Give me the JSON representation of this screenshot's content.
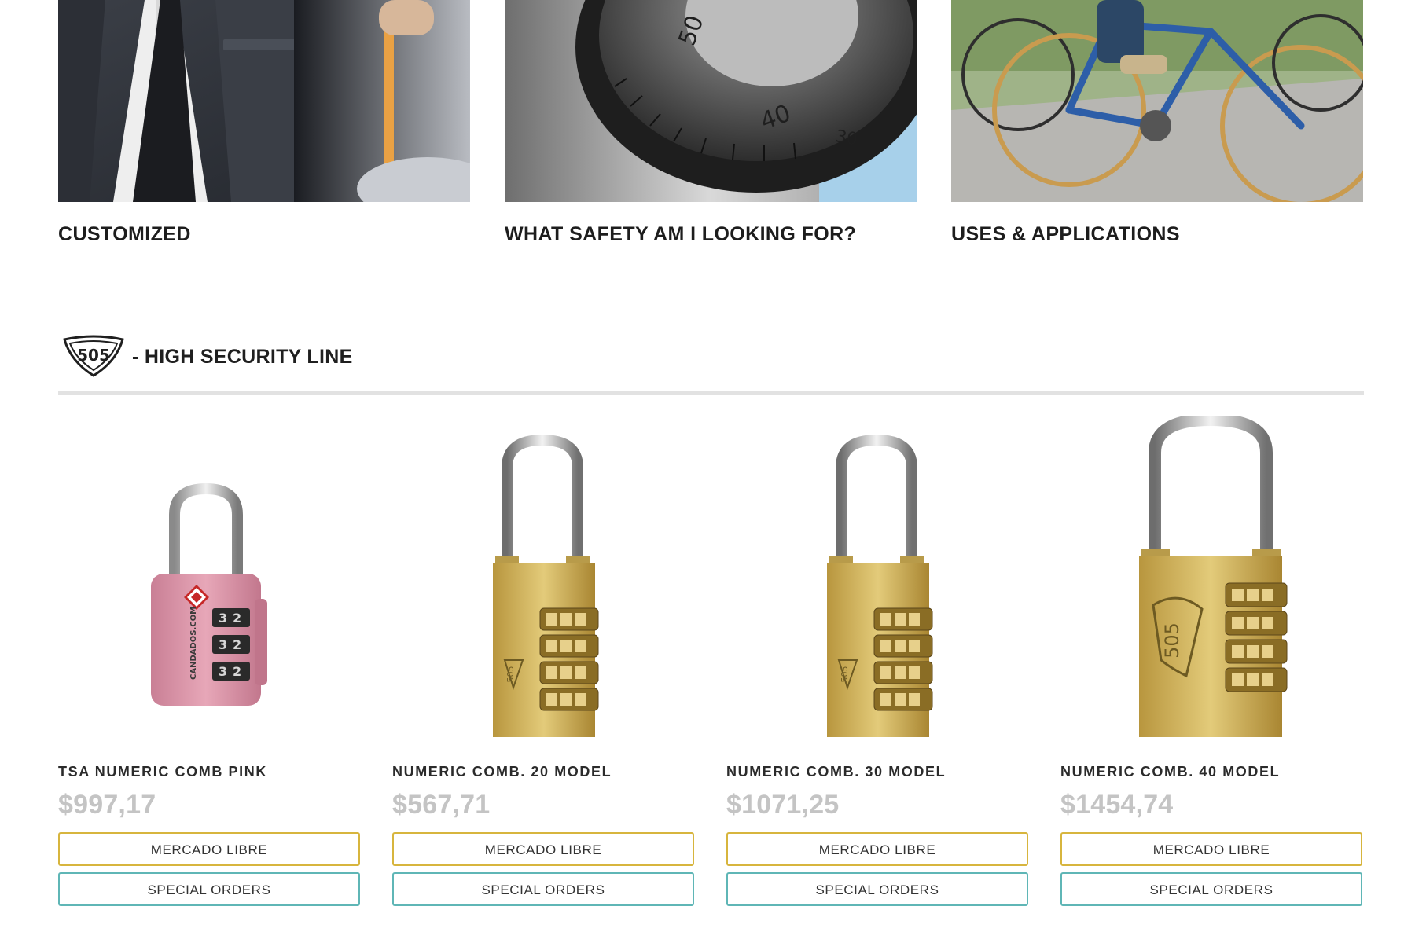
{
  "categories": [
    {
      "label": "CUSTOMIZED",
      "image_icon": "tailor-suit-photo"
    },
    {
      "label": "WHAT SAFETY AM I LOOKING FOR?",
      "image_icon": "safe-dial-photo"
    },
    {
      "label": "USES & APPLICATIONS",
      "image_icon": "bicycle-photo"
    }
  ],
  "section": {
    "logo_text": "505",
    "title": "- HIGH SECURITY LINE"
  },
  "products": [
    {
      "name": "TSA NUMERIC COMB PINK",
      "price": "$997,17",
      "buy_label": "MERCADO LIBRE",
      "order_label": "SPECIAL ORDERS",
      "image_icon": "pink-tsa-padlock",
      "body_text": "CANDADOS.COM"
    },
    {
      "name": "NUMERIC COMB. 20 MODEL",
      "price": "$567,71",
      "buy_label": "MERCADO LIBRE",
      "order_label": "SPECIAL ORDERS",
      "image_icon": "brass-combination-padlock"
    },
    {
      "name": "NUMERIC COMB. 30 MODEL",
      "price": "$1071,25",
      "buy_label": "MERCADO LIBRE",
      "order_label": "SPECIAL ORDERS",
      "image_icon": "brass-combination-padlock"
    },
    {
      "name": "NUMERIC COMB. 40 MODEL",
      "price": "$1454,74",
      "buy_label": "MERCADO LIBRE",
      "order_label": "SPECIAL ORDERS",
      "image_icon": "brass-combination-padlock"
    }
  ],
  "colors": {
    "price": "#c4c4c4",
    "mercado_border": "#d7b53e",
    "special_border": "#5fb6b6",
    "rule": "#e2e2e2"
  }
}
